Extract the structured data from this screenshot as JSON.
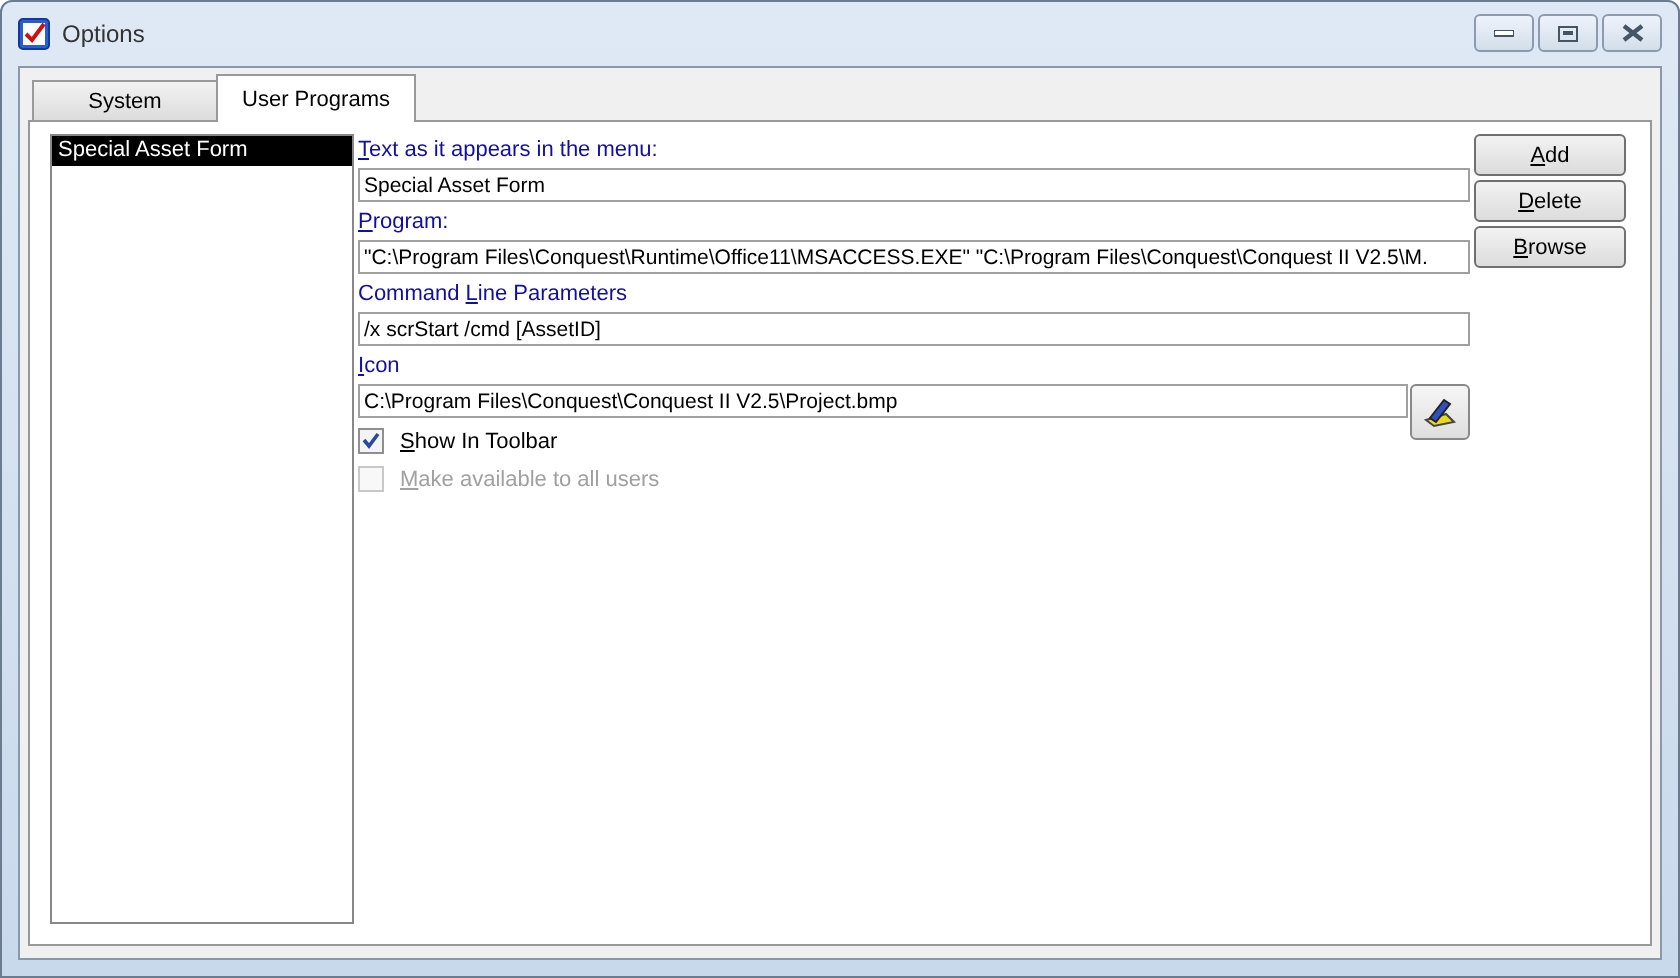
{
  "window": {
    "title": "Options"
  },
  "tabs": [
    {
      "label": "System",
      "selected": false
    },
    {
      "label": "User Programs",
      "selected": true
    }
  ],
  "program_list": {
    "items": [
      {
        "label": "Special Asset Form",
        "selected": true
      }
    ]
  },
  "fields": [
    {
      "label": {
        "key": "T",
        "after": "ext as it appears in the menu:"
      },
      "value": "Special Asset Form"
    },
    {
      "label": {
        "key": "P",
        "after": "rogram:"
      },
      "value": "\"C:\\Program Files\\Conquest\\Runtime\\Office11\\MSACCESS.EXE\" \"C:\\Program Files\\Conquest\\Conquest II V2.5\\M."
    },
    {
      "label": {
        "before": "Command ",
        "key": "L",
        "after": "ine Parameters"
      },
      "value": "/x scrStart /cmd [AssetID]"
    },
    {
      "label": {
        "key": "I",
        "after": "con"
      },
      "value": "C:\\Program Files\\Conquest\\Conquest II V2.5\\Project.bmp",
      "kind": "icon-picker"
    }
  ],
  "checkboxes": [
    {
      "label": {
        "key": "S",
        "after": "how In Toolbar"
      },
      "checked": true,
      "disabled": false
    },
    {
      "label": {
        "key": "M",
        "after": "ake available to all users"
      },
      "checked": false,
      "disabled": true
    }
  ],
  "buttons": [
    {
      "key": "A",
      "after": "dd"
    },
    {
      "key": "D",
      "after": "elete"
    },
    {
      "key": "B",
      "after": "rowse"
    }
  ]
}
